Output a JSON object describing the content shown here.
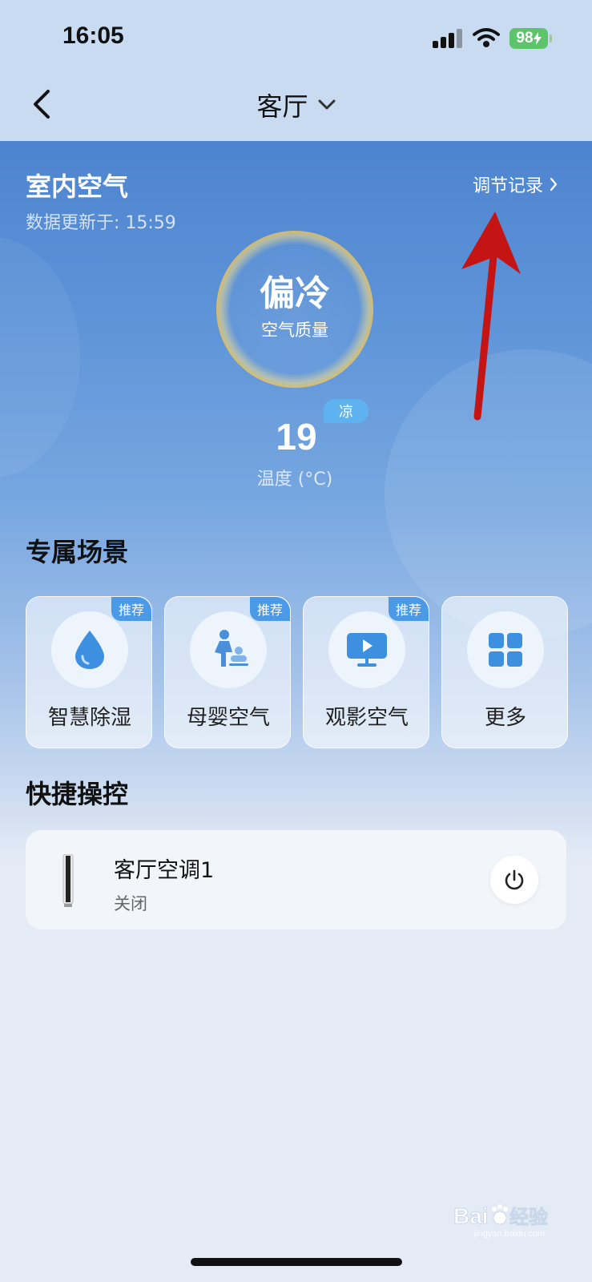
{
  "status_bar": {
    "time": "16:05",
    "battery": "98"
  },
  "nav": {
    "title": "客厅"
  },
  "air": {
    "title": "室内空气",
    "updated": "数据更新于: 15:59",
    "record_link": "调节记录",
    "quality_value": "偏冷",
    "quality_label": "空气质量",
    "temperature": "19",
    "temp_tag": "凉",
    "temp_label": "温度 (°C)"
  },
  "scenes": {
    "title": "专属场景",
    "items": [
      {
        "label": "智慧除湿",
        "badge": "推荐",
        "icon": "water-drop-icon"
      },
      {
        "label": "母婴空气",
        "badge": "推荐",
        "icon": "mother-baby-icon"
      },
      {
        "label": "观影空气",
        "badge": "推荐",
        "icon": "tv-play-icon"
      },
      {
        "label": "更多",
        "icon": "grid-icon"
      }
    ]
  },
  "quick_controls": {
    "title": "快捷操控",
    "device": {
      "name": "客厅空调1",
      "status": "关闭"
    }
  },
  "watermark": {
    "brand": "Baidu经验",
    "url": "jingyan.baidu.com"
  },
  "colors": {
    "hero_top": "#4d84cf",
    "accent_blue": "#4b9ae8",
    "ring_gold": "#f0be46",
    "annotation_red": "#c41414"
  }
}
